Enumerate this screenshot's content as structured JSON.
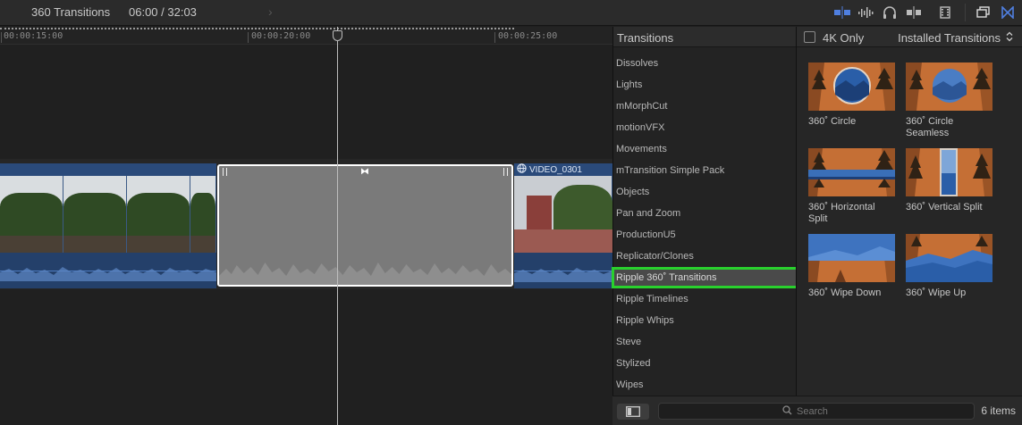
{
  "topbar": {
    "project_name": "360 Transitions",
    "timecode": "06:00 / 32:03"
  },
  "timeline": {
    "ruler_labels": [
      "00:00:15:00",
      "00:00:20:00",
      "00:00:25:00"
    ],
    "clip_right_name": "VIDEO_0301"
  },
  "browser": {
    "title": "Transitions",
    "categories": [
      "Dissolves",
      "Lights",
      "mMorphCut",
      "motionVFX",
      "Movements",
      "mTransition Simple Pack",
      "Objects",
      "Pan and Zoom",
      "ProductionU5",
      "Replicator/Clones",
      "Ripple 360˚ Transitions",
      "Ripple Timelines",
      "Ripple Whips",
      "Steve",
      "Stylized",
      "Wipes"
    ],
    "selected": "Ripple 360˚ Transitions"
  },
  "panel": {
    "filter_label": "4K Only",
    "filter_checked": false,
    "source_label": "Installed Transitions",
    "tiles": [
      {
        "label": "360˚ Circle"
      },
      {
        "label": "360˚ Circle Seamless"
      },
      {
        "label": "360˚ Horizontal Split"
      },
      {
        "label": "360˚ Vertical Split"
      },
      {
        "label": "360˚ Wipe Down"
      },
      {
        "label": "360˚ Wipe Up"
      }
    ]
  },
  "bottombar": {
    "search_placeholder": "Search",
    "item_count": "6 items"
  },
  "colors": {
    "selection_outline": "#29d12d",
    "clip_blue": "#2a4a7a",
    "accent_icon": "#4f7fe0"
  }
}
